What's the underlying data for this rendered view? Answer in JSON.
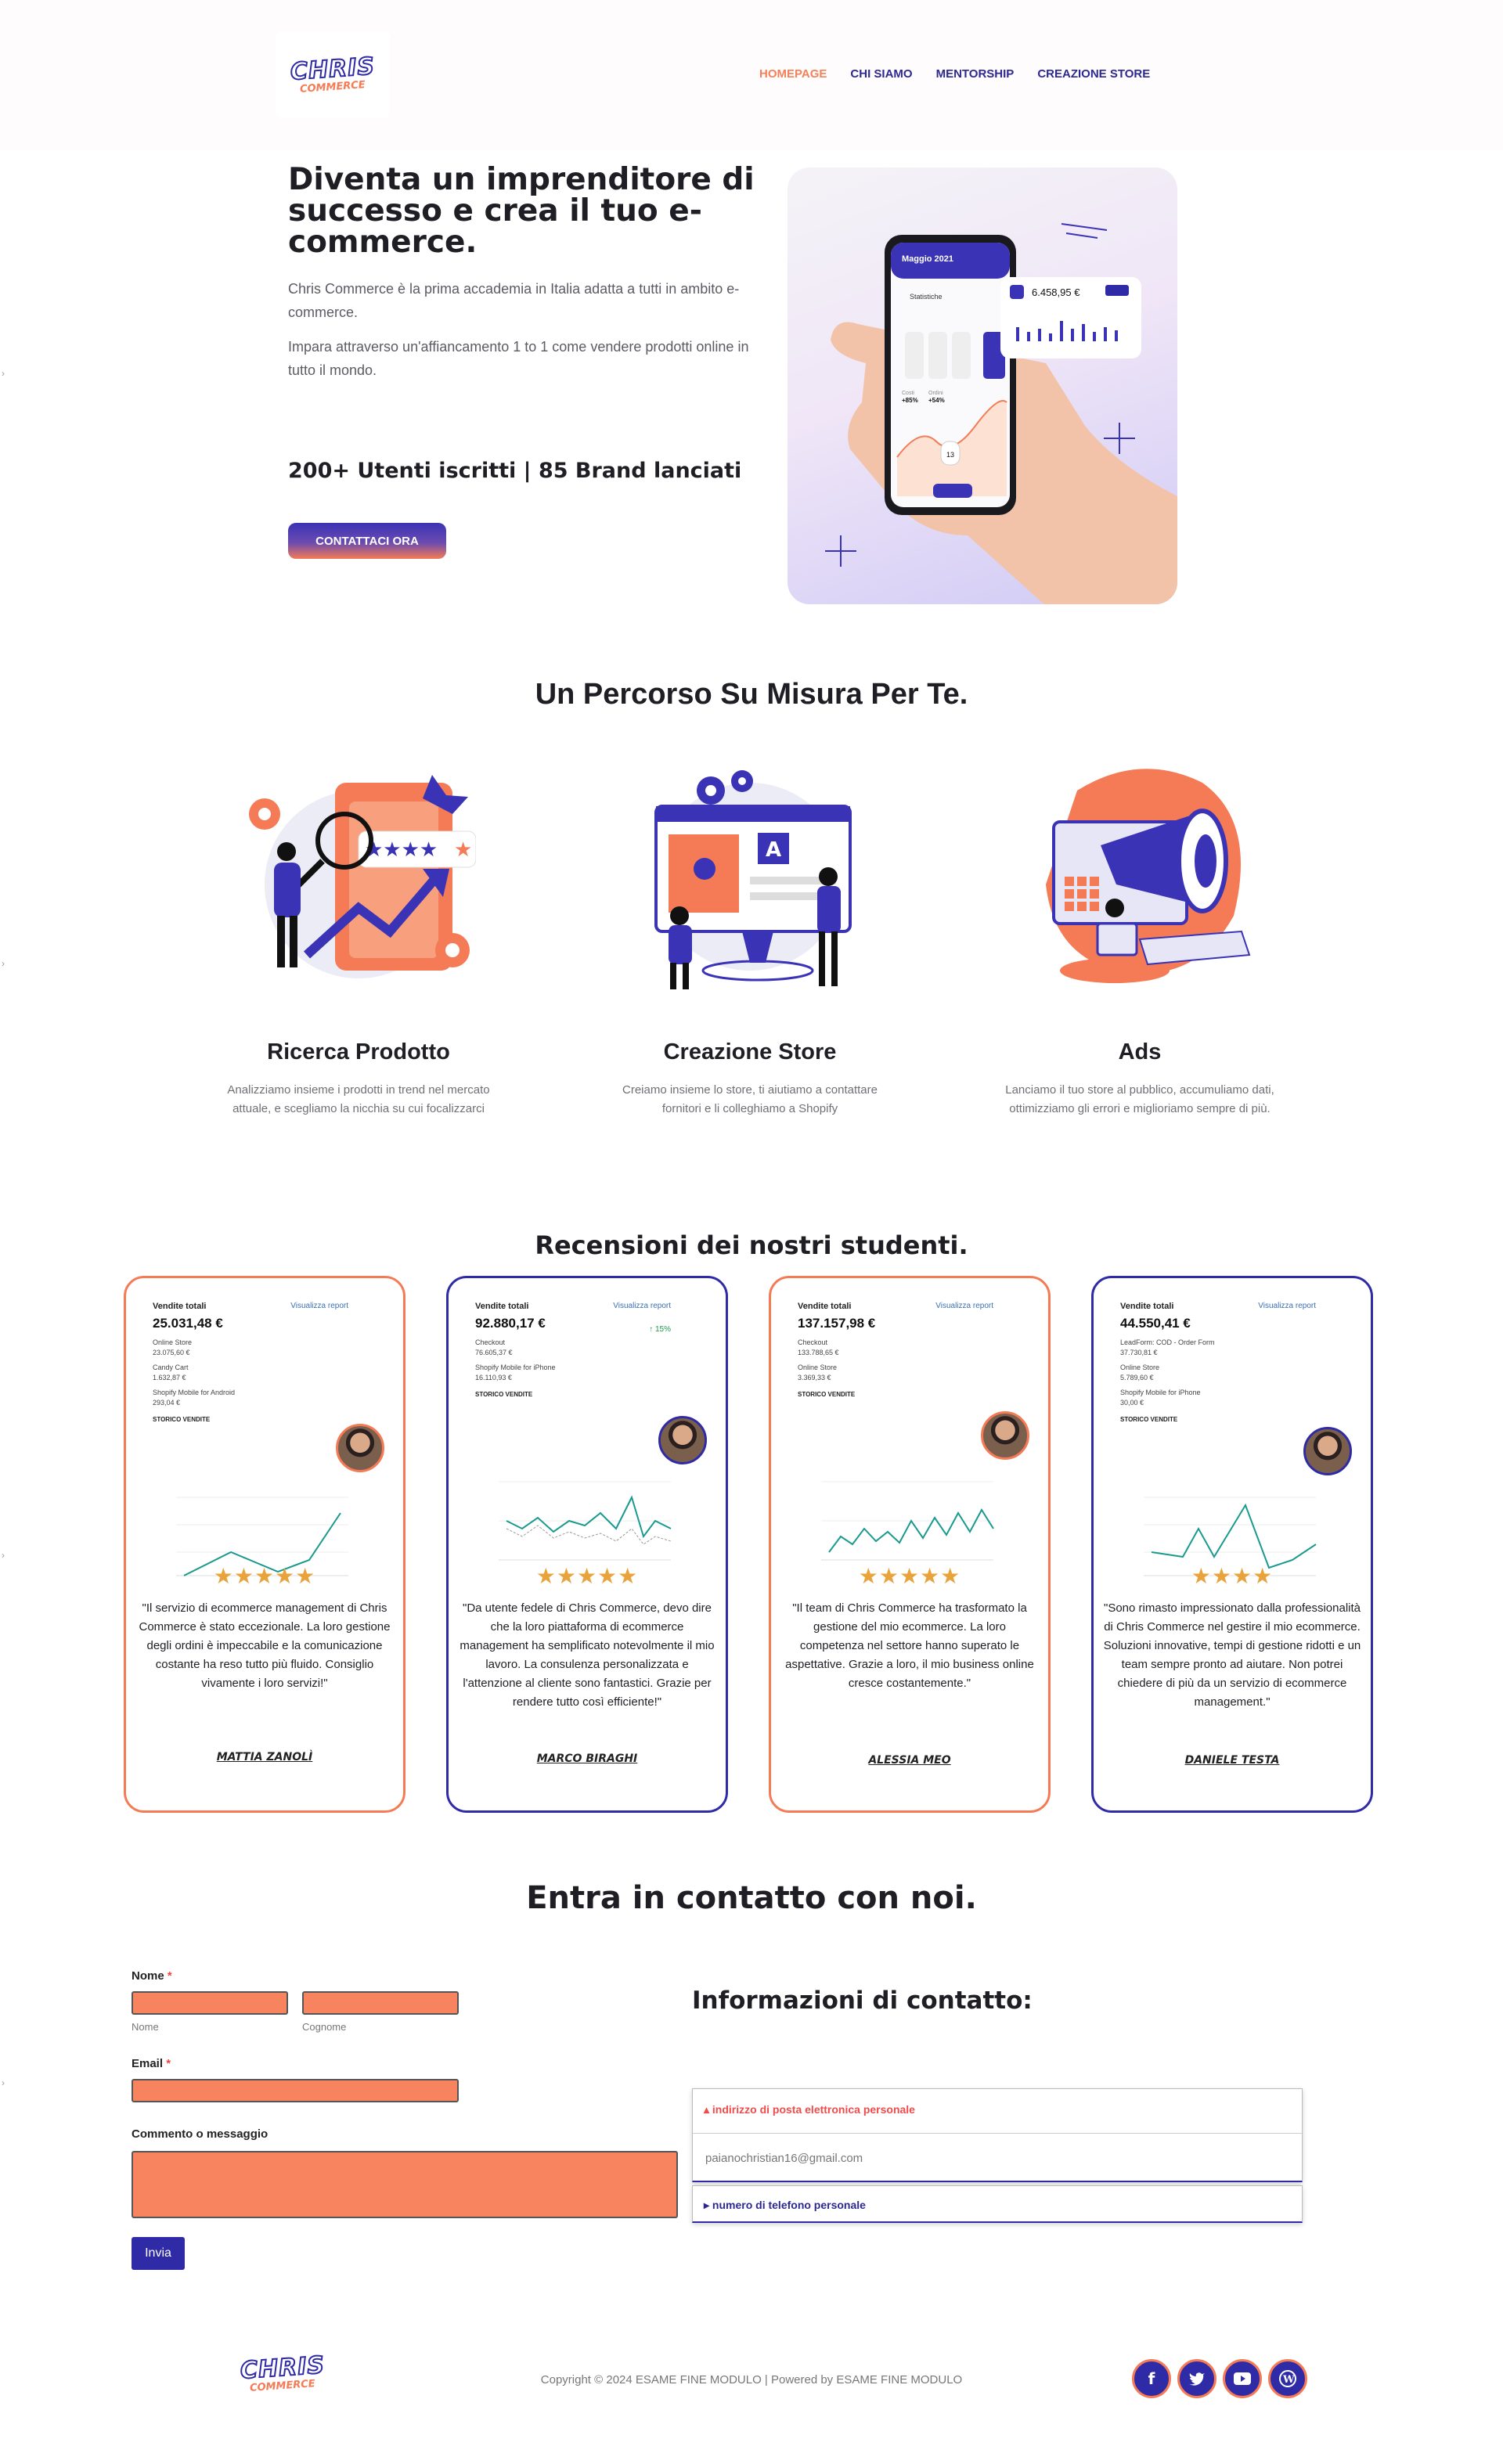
{
  "brand": {
    "logo_main": "CHRIS",
    "logo_sub": "COMMERCE"
  },
  "nav": {
    "items": [
      "HOMEPAGE",
      "CHI SIAMO",
      "MENTORSHIP",
      "CREAZIONE STORE"
    ]
  },
  "hero": {
    "title": "Diventa un imprenditore di successo e crea il tuo e-commerce.",
    "p1": "Chris Commerce è la prima accademia in Italia adatta a tutti in ambito e-commerce.",
    "p2": "Impara attraverso un'affiancamento 1 to 1 come vendere prodotti online in tutto il mondo.",
    "stats": "200+ Utenti iscritti | 85 Brand lanciati",
    "cta": "CONTATTACI ORA",
    "phone": {
      "month": "Maggio 2021",
      "section": "Statistiche",
      "amount": "6.458,95 €",
      "date_num": "13",
      "metric1": "+85%",
      "metric2": "+54%",
      "label1": "Costi",
      "label2": "Ordini"
    }
  },
  "percorso": {
    "title": "Un Percorso Su Misura Per Te.",
    "features": [
      {
        "title": "Ricerca Prodotto",
        "text": "Analizziamo insieme i prodotti in trend nel mercato attuale, e scegliamo la nicchia su cui focalizzarci"
      },
      {
        "title": "Creazione Store",
        "text": "Creiamo insieme lo store, ti aiutiamo a contattare fornitori e li colleghiamo a Shopify"
      },
      {
        "title": "Ads",
        "text": "Lanciamo il tuo store al pubblico, accumuliamo dati, ottimizziamo gli errori e miglioriamo sempre di più."
      }
    ]
  },
  "reviews": {
    "title": "Recensioni dei nostri studenti.",
    "common": {
      "label": "Vendite totali",
      "link": "Visualizza report",
      "storico": "STORICO VENDITE"
    },
    "items": [
      {
        "total": "25.031,48 €",
        "lines": [
          "Online Store",
          "23.075,60 €",
          "Candy Cart",
          "1.632,87 €",
          "Shopify Mobile for Android",
          "293,04 €"
        ],
        "quote": "\"Il servizio di ecommerce management di Chris Commerce è stato eccezionale. La loro gestione degli ordini è impeccabile e la comunicazione costante ha reso tutto più fluido. Consiglio vivamente i loro servizi!\"",
        "name": "MATTIA ZANOLÌ",
        "stars": "★★★★★"
      },
      {
        "total": "92.880,17 €",
        "badge": "↑ 15%",
        "lines": [
          "Checkout",
          "76.605,37 €",
          "Shopify Mobile for iPhone",
          "16.110,93 €"
        ],
        "quote": "\"Da utente fedele di Chris Commerce, devo dire che la loro piattaforma di ecommerce management ha semplificato notevolmente il mio lavoro. La consulenza personalizzata e l'attenzione al cliente sono fantastici. Grazie per rendere tutto così efficiente!\"",
        "name": "MARCO BIRAGHI",
        "stars": "★★★★★"
      },
      {
        "total": "137.157,98 €",
        "lines": [
          "Checkout",
          "133.788,65 €",
          "Online Store",
          "3.369,33 €"
        ],
        "quote": "\"Il team di Chris Commerce ha trasformato la gestione del mio ecommerce. La loro competenza nel settore  hanno superato le aspettative. Grazie a loro, il mio business online cresce costantemente.\"",
        "name": "ALESSIA MEO",
        "stars": "★★★★★"
      },
      {
        "total": "44.550,41 €",
        "lines": [
          "LeadForm: COD - Order Form",
          "37.730,81 €",
          "Online Store",
          "5.789,60 €",
          "Shopify Mobile for iPhone",
          "30,00 €"
        ],
        "quote": "\"Sono rimasto impressionato dalla professionalità di Chris Commerce nel gestire il mio ecommerce. Soluzioni innovative, tempi di gestione ridotti e un team sempre pronto ad aiutare. Non potrei chiedere di più da un servizio di ecommerce management.\"",
        "name": "DANIELE TESTA",
        "stars": "★★★★"
      }
    ]
  },
  "contact": {
    "title": "Entra in contatto con noi.",
    "name_label": "Nome",
    "required_mark": "*",
    "first_sub": "Nome",
    "last_sub": "Cognome",
    "email_label": "Email",
    "message_label": "Commento o messaggio",
    "submit": "Invia",
    "info_title": "Informazioni di contatto:",
    "acc1_title": "▴ indirizzo di posta elettronica personale",
    "acc1_value": "paianochristian16@gmail.com",
    "acc2_title": "▸ numero di telefono personale"
  },
  "footer": {
    "copyright": "Copyright © 2024 ESAME FINE MODULO | Powered by ESAME FINE MODULO",
    "socials": [
      "facebook-icon",
      "twitter-icon",
      "youtube-icon",
      "wordpress-icon"
    ]
  },
  "colors": {
    "primary": "#2f2aa5",
    "accent": "#f47b55",
    "text": "#1e1e24"
  }
}
